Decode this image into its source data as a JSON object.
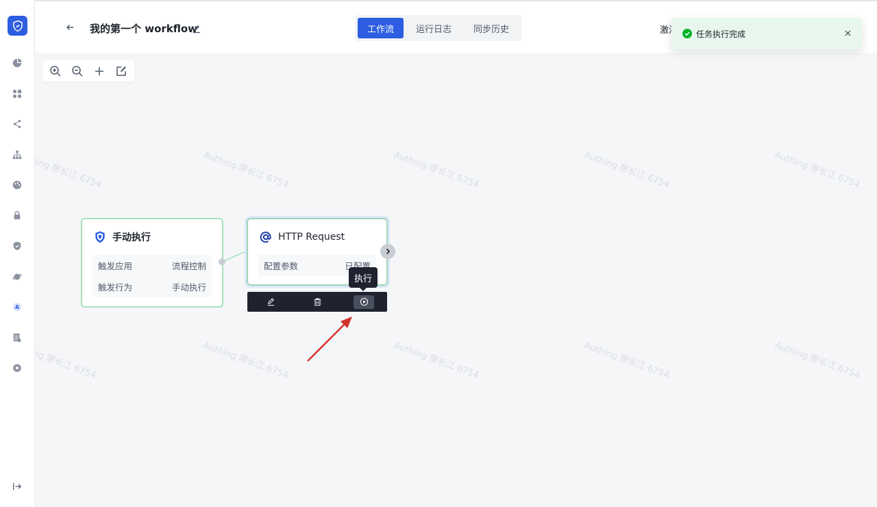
{
  "header": {
    "title": "我的第一个 workflow",
    "tabs": [
      {
        "label": "工作流",
        "active": true
      },
      {
        "label": "运行日志",
        "active": false
      },
      {
        "label": "同步历史",
        "active": false
      }
    ],
    "activate_label": "激活"
  },
  "sidebar": {
    "logo_icon": "shield-logo-icon",
    "items": [
      {
        "icon": "pie-chart-icon"
      },
      {
        "icon": "apps-icon"
      },
      {
        "icon": "share-icon"
      },
      {
        "icon": "org-tree-icon"
      },
      {
        "icon": "palette-icon"
      },
      {
        "icon": "lock-icon"
      },
      {
        "icon": "shield-check-icon"
      },
      {
        "icon": "planet-icon"
      },
      {
        "icon": "a-circle-icon"
      },
      {
        "icon": "document-icon"
      },
      {
        "icon": "gear-icon"
      }
    ],
    "collapse_icon": "collapse-icon"
  },
  "canvas": {
    "zoom_tools": [
      "zoom-in-icon",
      "zoom-out-icon",
      "plus-icon",
      "edit-square-icon"
    ],
    "watermark": "Authing 廖长江 6754",
    "nodes": [
      {
        "title": "手动执行",
        "icon": "shield-icon",
        "rows": [
          {
            "label": "触发应用",
            "value": "流程控制"
          },
          {
            "label": "触发行为",
            "value": "手动执行"
          }
        ]
      },
      {
        "title": "HTTP Request",
        "icon": "at-icon",
        "rows": [
          {
            "label": "配置参数",
            "value": "已配置"
          }
        ]
      }
    ],
    "node_toolbar": [
      "edit-icon",
      "trash-icon",
      "play-circle-icon"
    ],
    "tooltip": "执行"
  },
  "toast": {
    "text": "任务执行完成",
    "icon": "check-circle-icon",
    "close_icon": "close-icon"
  },
  "colors": {
    "primary": "#2d5de0",
    "node_border": "#a6e1bd",
    "success": "#00b42a",
    "toast_bg": "#e8f7ee",
    "annotation_arrow": "#d0342c"
  }
}
